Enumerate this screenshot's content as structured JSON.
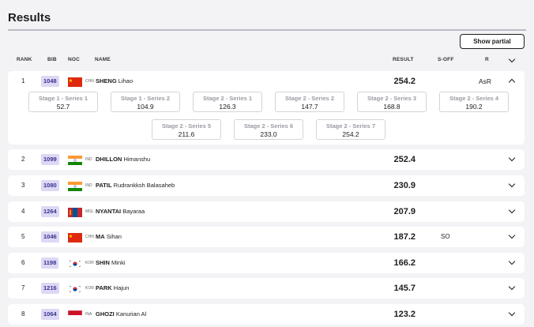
{
  "page": {
    "title": "Results",
    "show_button": "Show partial"
  },
  "columns": {
    "rank": "RANK",
    "bib": "BIB",
    "noc": "NOC",
    "name": "NAME",
    "result": "RESULT",
    "soff": "S-OFF",
    "r": "R"
  },
  "rows": [
    {
      "rank": "1",
      "bib": "1048",
      "noc": "CHN",
      "surname": "SHENG",
      "given": "Lihao",
      "result": "254.2",
      "soff": "",
      "record": "AsR",
      "expanded": true,
      "flag": "chn"
    },
    {
      "rank": "2",
      "bib": "1099",
      "noc": "IND",
      "surname": "DHILLON",
      "given": "Himanshu",
      "result": "252.4",
      "soff": "",
      "record": "",
      "flag": "ind"
    },
    {
      "rank": "3",
      "bib": "1080",
      "noc": "IND",
      "surname": "PATIL",
      "given": "Rudrankksh Balasaheb",
      "result": "230.9",
      "soff": "",
      "record": "",
      "flag": "ind"
    },
    {
      "rank": "4",
      "bib": "1264",
      "noc": "MGL",
      "surname": "NYANTAI",
      "given": "Bayaraa",
      "result": "207.9",
      "soff": "",
      "record": "",
      "flag": "mgl"
    },
    {
      "rank": "5",
      "bib": "1046",
      "noc": "CHN",
      "surname": "MA",
      "given": "Sihan",
      "result": "187.2",
      "soff": "SO",
      "record": "",
      "flag": "chn"
    },
    {
      "rank": "6",
      "bib": "1198",
      "noc": "KOR",
      "surname": "SHIN",
      "given": "Minki",
      "result": "166.2",
      "soff": "",
      "record": "",
      "flag": "kor"
    },
    {
      "rank": "7",
      "bib": "1216",
      "noc": "KOR",
      "surname": "PARK",
      "given": "Hajun",
      "result": "145.7",
      "soff": "",
      "record": "",
      "flag": "kor"
    },
    {
      "rank": "8",
      "bib": "1064",
      "noc": "INA",
      "surname": "GHOZI",
      "given": "Kanurian Al",
      "result": "123.2",
      "soff": "",
      "record": "",
      "flag": "ina"
    }
  ],
  "series": [
    {
      "label": "Stage 1 - Series 1",
      "value": "52.7"
    },
    {
      "label": "Stage 1 - Series 2",
      "value": "104.9"
    },
    {
      "label": "Stage 2 - Series 1",
      "value": "126.3"
    },
    {
      "label": "Stage 2 - Series 2",
      "value": "147.7"
    },
    {
      "label": "Stage 2 - Series 3",
      "value": "168.8"
    },
    {
      "label": "Stage 2 - Series 4",
      "value": "190.2"
    },
    {
      "label": "Stage 2 - Series 5",
      "value": "211.6"
    },
    {
      "label": "Stage 2 - Series 6",
      "value": "233.0"
    },
    {
      "label": "Stage 2 - Series 7",
      "value": "254.2"
    }
  ],
  "colors": {
    "bib_bg": "#dcd8f5",
    "bib_text": "#39338f",
    "china_red": "#de2910",
    "india_saffron": "#ff9933",
    "india_green": "#138808",
    "mongolia_red": "#c4272f",
    "mongolia_blue": "#015197",
    "indonesia_red": "#ce1126"
  }
}
